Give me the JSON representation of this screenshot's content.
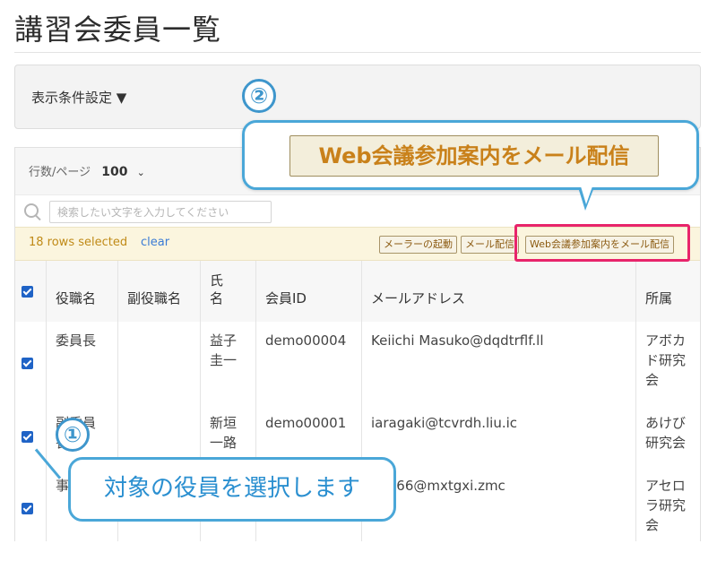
{
  "page": {
    "title": "講習会委員一覧"
  },
  "filter": {
    "toggle_label": "表示条件設定 ▼"
  },
  "grid": {
    "page_size_label": "行数/ページ",
    "page_size_value": "100",
    "page_size_chevron": "⌄",
    "search_placeholder": "検索したい文字を入力してください",
    "selection": {
      "count_label": "18 rows selected",
      "clear_label": "clear"
    },
    "actions": {
      "mailer_label": "メーラーの起動",
      "mail_send_label": "メール配信",
      "web_meeting_label": "Web会議参加案内をメール配信"
    },
    "columns": [
      "役職名",
      "副役職名",
      "氏名",
      "会員ID",
      "メールアドレス",
      "所属"
    ],
    "rows": [
      {
        "checked": true,
        "role": "委員長",
        "sub_role": "",
        "name": "益子圭一",
        "member_id": "demo00004",
        "email": "Keiichi Masuko@dqdtrflf.ll",
        "affiliation": "アボカド研究会"
      },
      {
        "checked": true,
        "role": "副委員長",
        "sub_role": "",
        "name": "新垣一路",
        "member_id": "demo00001",
        "email": "iaragaki@tcvrdh.liu.ic",
        "affiliation": "あけび研究会"
      },
      {
        "checked": true,
        "role": "事",
        "sub_role": "",
        "name": "",
        "member_id": "",
        "email": "a0666@mxtgxi.zmc",
        "affiliation": "アセロラ研究会"
      }
    ]
  },
  "annotations": {
    "badge_1": "①",
    "badge_2": "②",
    "callout_top_button": "Web会議参加案内をメール配信",
    "callout_bottom_text": "対象の役員を選択します"
  },
  "colors": {
    "accent_blue": "#4aa7d8",
    "highlight_pink": "#e8246b",
    "checkbox_blue": "#1f63c6",
    "selection_bar": "#fbf5de",
    "button_text": "#c9811a"
  }
}
